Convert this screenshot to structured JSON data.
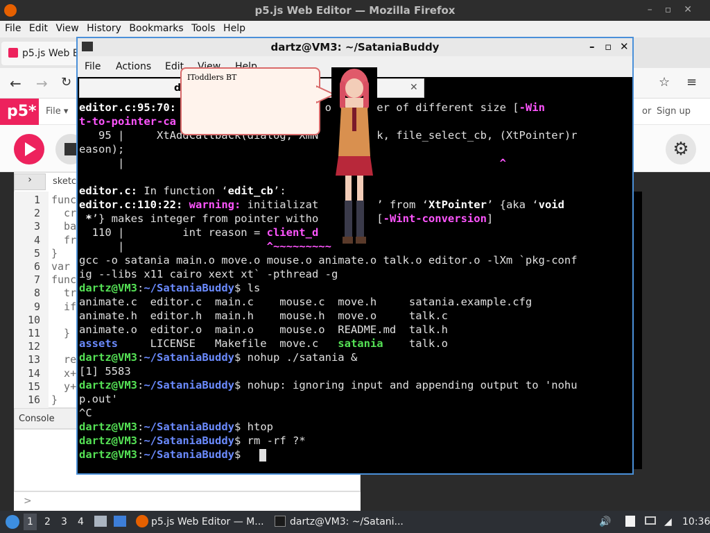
{
  "firefox": {
    "window_title": "p5.js Web Editor — Mozilla Firefox",
    "menu": [
      "File",
      "Edit",
      "View",
      "History",
      "Bookmarks",
      "Tools",
      "Help"
    ],
    "tab_label": "p5.js Web E"
  },
  "p5": {
    "logo": "p5*",
    "file_menu": "File ▾",
    "login": "or",
    "signup": "Sign up",
    "sketch_tab": "sketch",
    "console_label": "Console",
    "console_prompt": ">",
    "line_numbers": [
      "1",
      "2",
      "3",
      "4",
      "5",
      "6",
      "7",
      "8",
      "9",
      "10",
      "11",
      "12",
      "13",
      "14",
      "15",
      "16"
    ],
    "code_lines": [
      "func",
      "  cr",
      "  ba",
      "  fr",
      "}",
      "var",
      "func",
      "  tr",
      "  if",
      "",
      "  }",
      "",
      "  re",
      "  x+",
      "  y+",
      "}"
    ]
  },
  "terminal": {
    "title": "dartz@VM3: ~/SataniaBuddy",
    "menu": [
      "File",
      "Actions",
      "Edit",
      "View",
      "Help"
    ],
    "tab_label": "da",
    "bubble_text": "IToddlers BT",
    "lines": [
      {
        "segs": [
          {
            "t": "editor.c:95:70:",
            "c": "w"
          },
          {
            "t": "                       "
          },
          {
            "t": "om integer of different size [",
            "c": ""
          },
          {
            "t": "-Win",
            "c": "m"
          }
        ]
      },
      {
        "segs": [
          {
            "t": "t-to-pointer-ca",
            "c": "m"
          }
        ]
      },
      {
        "segs": [
          {
            "t": "   95 |     XtAddCallback(dialog, XmN      back, file_select_cb, (XtPointer)r"
          }
        ]
      },
      {
        "segs": [
          {
            "t": "eason);"
          }
        ]
      },
      {
        "segs": [
          {
            "t": "      |                                                          "
          },
          {
            "t": "^",
            "c": "m"
          }
        ]
      },
      {
        "segs": [
          {
            "t": ""
          }
        ]
      },
      {
        "segs": [
          {
            "t": "editor.c:",
            "c": "w"
          },
          {
            "t": " In function ‘"
          },
          {
            "t": "edit_cb",
            "c": "w"
          },
          {
            "t": "’:"
          }
        ]
      },
      {
        "segs": [
          {
            "t": "editor.c:110:22:",
            "c": "w"
          },
          {
            "t": " "
          },
          {
            "t": "warning:",
            "c": "m"
          },
          {
            "t": " initializat     ‘"
          },
          {
            "t": "int",
            "c": "w"
          },
          {
            "t": "’ from ‘"
          },
          {
            "t": "XtPointer",
            "c": "w"
          },
          {
            "t": "’ {aka ‘"
          },
          {
            "t": "void",
            "c": "w"
          }
        ]
      },
      {
        "segs": [
          {
            "t": " *",
            "c": "w"
          },
          {
            "t": "’} makes integer from pointer witho     ast ["
          },
          {
            "t": "-Wint-conversion",
            "c": "m"
          },
          {
            "t": "]"
          }
        ]
      },
      {
        "segs": [
          {
            "t": "  110 |         int reason = "
          },
          {
            "t": "client_d",
            "c": "m"
          }
        ]
      },
      {
        "segs": [
          {
            "t": "      |                      "
          },
          {
            "t": "^~~~~~~~~~",
            "c": "m"
          }
        ]
      },
      {
        "segs": [
          {
            "t": "gcc -o satania main.o move.o mouse.o animate.o talk.o editor.o -lXm `pkg-conf"
          }
        ]
      },
      {
        "segs": [
          {
            "t": "ig --libs x11 cairo xext xt` -pthread -g"
          }
        ]
      },
      {
        "segs": [
          {
            "t": "dartz@VM3",
            "c": "g"
          },
          {
            "t": ":"
          },
          {
            "t": "~/SataniaBuddy",
            "c": "b"
          },
          {
            "t": "$ ls"
          }
        ]
      },
      {
        "segs": [
          {
            "t": "animate.c  editor.c  main.c    mouse.c  move.h     satania.example.cfg"
          }
        ]
      },
      {
        "segs": [
          {
            "t": "animate.h  editor.h  main.h    mouse.h  move.o     talk.c"
          }
        ]
      },
      {
        "segs": [
          {
            "t": "animate.o  editor.o  main.o    mouse.o  README.md  talk.h"
          }
        ]
      },
      {
        "segs": [
          {
            "t": "assets",
            "c": "b"
          },
          {
            "t": "     LICENSE   Makefile  move.c   "
          },
          {
            "t": "satania",
            "c": "g"
          },
          {
            "t": "    talk.o"
          }
        ]
      },
      {
        "segs": [
          {
            "t": "dartz@VM3",
            "c": "g"
          },
          {
            "t": ":"
          },
          {
            "t": "~/SataniaBuddy",
            "c": "b"
          },
          {
            "t": "$ nohup ./satania &"
          }
        ]
      },
      {
        "segs": [
          {
            "t": "[1] 5583"
          }
        ]
      },
      {
        "segs": [
          {
            "t": "dartz@VM3",
            "c": "g"
          },
          {
            "t": ":"
          },
          {
            "t": "~/SataniaBuddy",
            "c": "b"
          },
          {
            "t": "$ nohup: ignoring input and appending output to 'nohu"
          }
        ]
      },
      {
        "segs": [
          {
            "t": "p.out'"
          }
        ]
      },
      {
        "segs": [
          {
            "t": "^C"
          }
        ]
      },
      {
        "segs": [
          {
            "t": "dartz@VM3",
            "c": "g"
          },
          {
            "t": ":"
          },
          {
            "t": "~/SataniaBuddy",
            "c": "b"
          },
          {
            "t": "$ htop"
          }
        ]
      },
      {
        "segs": [
          {
            "t": "dartz@VM3",
            "c": "g"
          },
          {
            "t": ":"
          },
          {
            "t": "~/SataniaBuddy",
            "c": "b"
          },
          {
            "t": "$ rm -rf ?*"
          }
        ]
      },
      {
        "segs": [
          {
            "t": "dartz@VM3",
            "c": "g"
          },
          {
            "t": ":"
          },
          {
            "t": "~/SataniaBuddy",
            "c": "b"
          },
          {
            "t": "$ "
          }
        ]
      }
    ]
  },
  "taskbar": {
    "workspaces": [
      "1",
      "2",
      "3",
      "4"
    ],
    "firefox_task": "p5.js Web Editor — M...",
    "terminal_task": "dartz@VM3: ~/Satani...",
    "clock": "10:36"
  },
  "colors": {
    "accent": "#ed225d",
    "terminal_border": "#4a90d9",
    "prompt_user": "#55e155",
    "prompt_path": "#6b8bff",
    "highlight": "#ff55ff"
  }
}
